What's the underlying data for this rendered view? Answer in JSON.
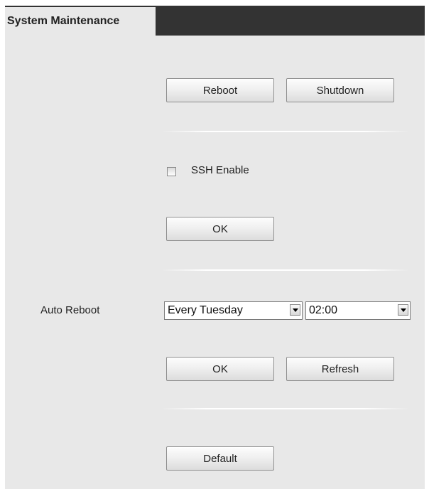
{
  "tabs": {
    "active_label": "System Maintenance"
  },
  "power": {
    "reboot_label": "Reboot",
    "shutdown_label": "Shutdown"
  },
  "ssh": {
    "enable_label": "SSH Enable",
    "enabled": false,
    "ok_label": "OK"
  },
  "auto_reboot": {
    "label": "Auto Reboot",
    "day_value": "Every Tuesday",
    "time_value": "02:00",
    "ok_label": "OK",
    "refresh_label": "Refresh"
  },
  "default_section": {
    "default_label": "Default"
  },
  "colors": {
    "tab_bar": "#333333",
    "panel_background": "#e8e8e8",
    "button_border": "#8f8f8f"
  }
}
